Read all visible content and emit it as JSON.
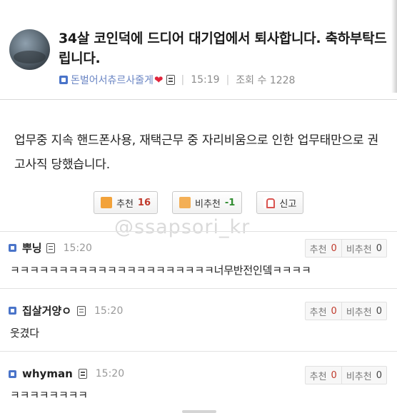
{
  "post": {
    "title": "34살 코인덕에 드디어 대기업에서 퇴사합니다. 축하부탁드립니다.",
    "author": "돈벌어서츄르사줄게",
    "time": "15:19",
    "views_label": "조회 수 1228",
    "body": "업무중 지속 핸드폰사용, 재택근무 중 자리비움으로 인한 업무태만으로 권고사직 당했습니다."
  },
  "votes": {
    "recommend_label": "추천",
    "recommend_count": "16",
    "not_recommend_label": "비추천",
    "not_recommend_count": "-1",
    "report_label": "신고"
  },
  "watermark": "@ssapsori_kr",
  "comments": [
    {
      "name": "뿌닝",
      "time": "15:20",
      "text": "ㅋㅋㅋㅋㅋㅋㅋㅋㅋㅋㅋㅋㅋㅋㅋㅋㅋㅋㅋㅋㅋ너무반전인뎈ㅋㅋㅋㅋ",
      "rec_label": "추천",
      "rec": "0",
      "nrec_label": "비추천",
      "nrec": "0"
    },
    {
      "name": "집살거양ㅇ",
      "time": "15:20",
      "text": "웃겼다",
      "rec_label": "추천",
      "rec": "0",
      "nrec_label": "비추천",
      "nrec": "0"
    },
    {
      "name": "whyman",
      "time": "15:20",
      "text": "ㅋㅋㅋㅋㅋㅋㅋㅋ",
      "rec_label": "추천",
      "rec": "0",
      "nrec_label": "비추천",
      "nrec": "0"
    }
  ],
  "colors": {
    "accent_up": "#c0392b",
    "accent_down": "#2e8b2e",
    "heart": "#e0243b",
    "author": "#6b86c4"
  },
  "icons": [
    "level-icon",
    "heart-icon",
    "memo-icon",
    "thumbs-up-icon",
    "thumbs-down-icon",
    "report-icon"
  ]
}
